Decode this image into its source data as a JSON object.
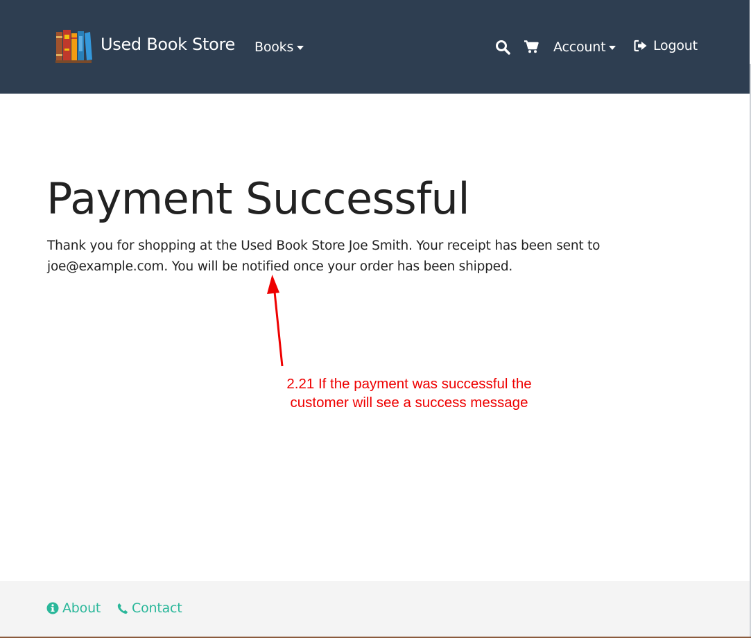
{
  "navbar": {
    "brand_text": "Used Book Store",
    "books_label": "Books",
    "account_label": "Account",
    "logout_label": "Logout",
    "icons": [
      "books-logo-icon",
      "search-icon",
      "cart-icon",
      "logout-icon"
    ],
    "background_color": "#2e3e51"
  },
  "main": {
    "title": "Payment Successful",
    "message": "Thank you for shopping at the Used Book Store Joe Smith. Your receipt has been sent to joe@example.com. You will be notified once your order has been shipped."
  },
  "annotation": {
    "text": "2.21  If the payment was successful the\ncustomer will see a success message",
    "color": "#ee0000"
  },
  "footer": {
    "about_label": "About",
    "contact_label": "Contact",
    "link_color": "#2ab79a",
    "icons": [
      "info-circle-icon",
      "phone-icon"
    ]
  }
}
